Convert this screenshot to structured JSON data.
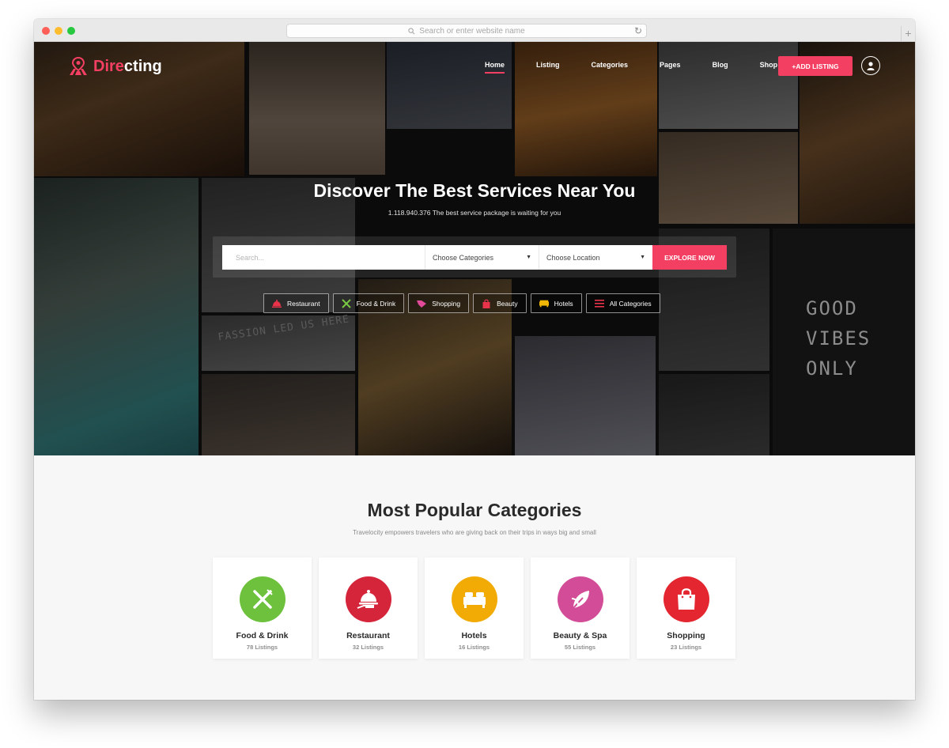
{
  "browser": {
    "url_placeholder": "Search or enter website name"
  },
  "brand": {
    "logo_part1": "Dire",
    "logo_part2": "cting",
    "accent_color": "#f33f62"
  },
  "nav": {
    "items": [
      {
        "label": "Home",
        "active": true
      },
      {
        "label": "Listing"
      },
      {
        "label": "Categories"
      },
      {
        "label": "Pages"
      },
      {
        "label": "Blog"
      },
      {
        "label": "Shop"
      }
    ],
    "add_listing_label": "+ADD LISTING",
    "user_icon": "user-icon"
  },
  "hero": {
    "title": "Discover The Best Services Near You",
    "subtitle": "1.118.940.376 The best service package is waiting for you",
    "sign_text": "GOOD VIBES ONLY",
    "wall_text": "FASSION LED US HERE"
  },
  "search": {
    "placeholder": "Search...",
    "category_select": "Choose Categories",
    "location_select": "Choose Location",
    "explore_label": "EXPLORE NOW"
  },
  "quick_categories": [
    {
      "label": "Restaurant",
      "icon": "cloche-icon",
      "color": "#e8334a"
    },
    {
      "label": "Food & Drink",
      "icon": "utensils-icon",
      "color": "#7ac943"
    },
    {
      "label": "Shopping",
      "icon": "tag-icon",
      "color": "#e24a9a"
    },
    {
      "label": "Beauty",
      "icon": "bag-icon",
      "color": "#e8334a"
    },
    {
      "label": "Hotels",
      "icon": "bed-icon",
      "color": "#f2b705"
    },
    {
      "label": "All Categories",
      "icon": "list-icon",
      "color": "#e8334a"
    }
  ],
  "popular": {
    "title": "Most Popular Categories",
    "subtitle": "Travelocity empowers travelers who are giving back on their trips in ways big and small",
    "cards": [
      {
        "name": "Food & Drink",
        "count": "78 Listings",
        "color": "#6dc13c",
        "icon": "utensils-icon"
      },
      {
        "name": "Restaurant",
        "count": "32 Listings",
        "color": "#d5253b",
        "icon": "cloche-icon"
      },
      {
        "name": "Hotels",
        "count": "16 Listings",
        "color": "#f2ab05",
        "icon": "bed-icon"
      },
      {
        "name": "Beauty & Spa",
        "count": "55 Listings",
        "color": "#d24c97",
        "icon": "leaf-icon"
      },
      {
        "name": "Shopping",
        "count": "23 Listings",
        "color": "#e3262f",
        "icon": "shopping-bag-icon"
      }
    ]
  }
}
